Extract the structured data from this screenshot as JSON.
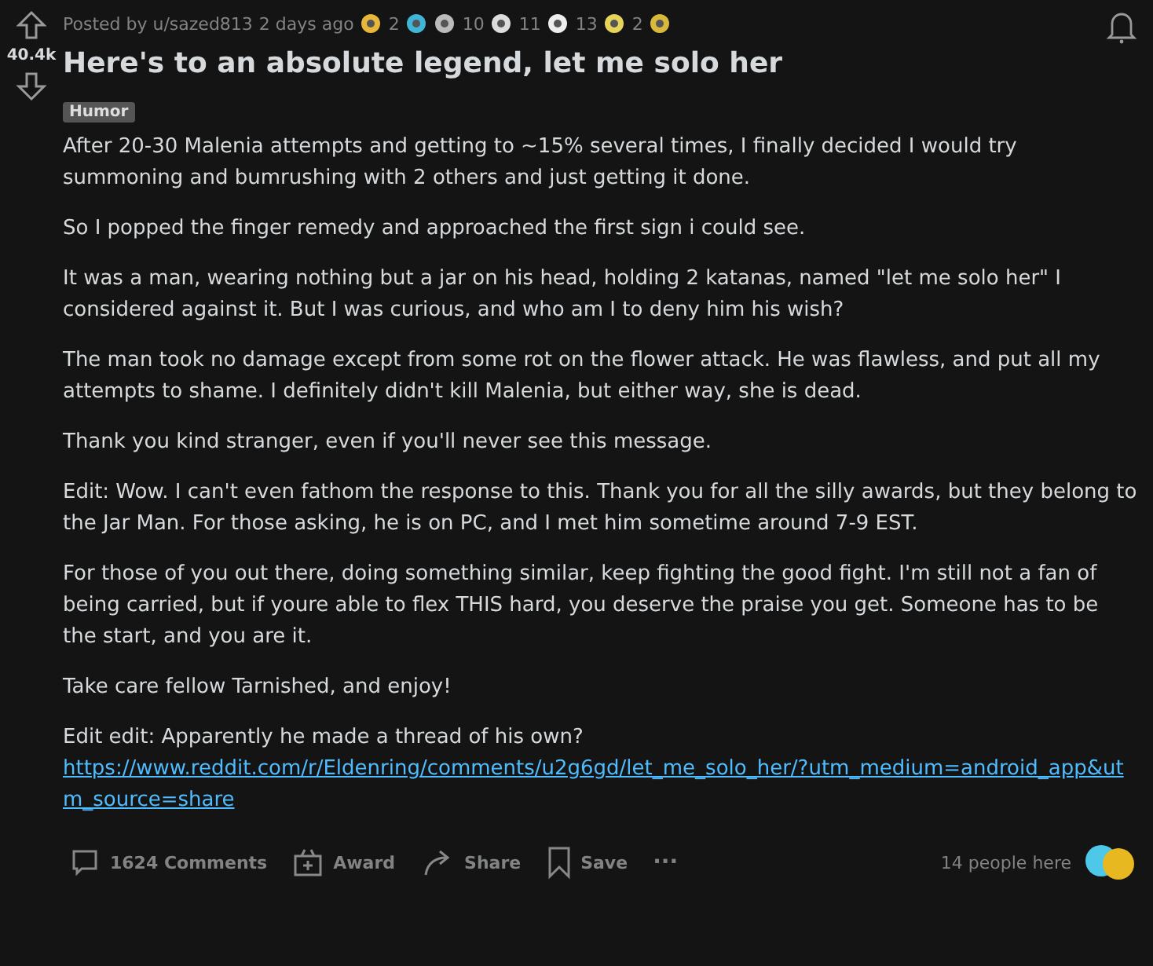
{
  "vote": {
    "score": "40.4k"
  },
  "post": {
    "posted_by": "Posted by u/sazed813",
    "time": "2 days ago",
    "awards": [
      {
        "kind": "medal",
        "count": "2"
      },
      {
        "kind": "arrow"
      },
      {
        "kind": "hands",
        "count": "10"
      },
      {
        "kind": "face",
        "count": "11"
      },
      {
        "kind": "coin",
        "count": "13"
      },
      {
        "kind": "sun",
        "count": "2"
      },
      {
        "kind": "grin"
      }
    ],
    "title": "Here's to an absolute legend, let me solo her",
    "flair": "Humor",
    "paragraphs": [
      {
        "text": "After 20-30 Malenia attempts and getting to ~15% several times, I finally decided I would try summoning and bumrushing with 2 others and just getting it done."
      },
      {
        "text": "So I popped the finger remedy and approached the first sign i could see."
      },
      {
        "text": "It was a man, wearing nothing but a jar on his head, holding 2 katanas, named \"let me solo her\" I considered against it. But I was curious, and who am I to deny him his wish?"
      },
      {
        "text": "The man took no damage except from some rot on the flower attack. He was flawless, and put all my attempts to shame. I definitely didn't kill Malenia, but either way, she is dead."
      },
      {
        "text": "Thank you kind stranger, even if you'll never see this message."
      },
      {
        "text": "Edit: Wow. I can't even fathom the response to this. Thank you for all the silly awards, but they belong to the Jar Man. For those asking, he is on PC, and I met him sometime around 7-9 EST."
      },
      {
        "text": "For those of you out there, doing something similar, keep fighting the good fight. I'm still not a fan of being carried, but if youre able to flex THIS hard, you deserve the praise you get. Someone has to be the start, and you are it."
      },
      {
        "text": "Take care fellow Tarnished, and enjoy!"
      },
      {
        "text": "Edit edit: Apparently he made a thread of his own?",
        "link": "https://www.reddit.com/r/Eldenring/comments/u2g6gd/let_me_solo_her/?utm_medium=android_app&utm_source=share"
      }
    ]
  },
  "actions": [
    {
      "kind": "comments",
      "label": "1624 Comments"
    },
    {
      "kind": "award",
      "label": "Award"
    },
    {
      "kind": "share",
      "label": "Share"
    },
    {
      "kind": "save",
      "label": "Save"
    },
    {
      "kind": "more",
      "label": "···"
    }
  ],
  "presence": "14 people here"
}
